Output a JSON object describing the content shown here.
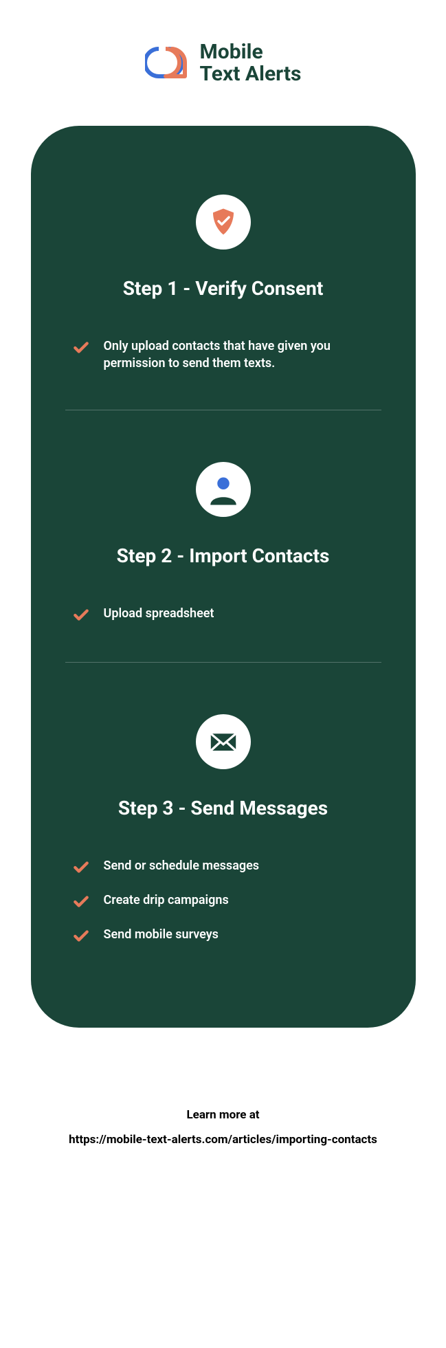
{
  "logo": {
    "line1": "Mobile",
    "line2": "Text Alerts"
  },
  "steps": [
    {
      "title": "Step 1 - Verify Consent",
      "icon": "shield-check",
      "items": [
        "Only upload contacts that have given you permission to send them texts."
      ]
    },
    {
      "title": "Step 2 - Import Contacts",
      "icon": "person",
      "items": [
        "Upload spreadsheet"
      ]
    },
    {
      "title": "Step 3 - Send Messages",
      "icon": "envelope",
      "items": [
        "Send or schedule messages",
        "Create drip campaigns",
        "Send mobile surveys"
      ]
    }
  ],
  "footer": {
    "line1": "Learn more at",
    "line2": "https://mobile-text-alerts.com/articles/importing-contacts"
  },
  "colors": {
    "cardBg": "#1a4538",
    "accent": "#e77a5a",
    "blue": "#3a6fd8"
  }
}
